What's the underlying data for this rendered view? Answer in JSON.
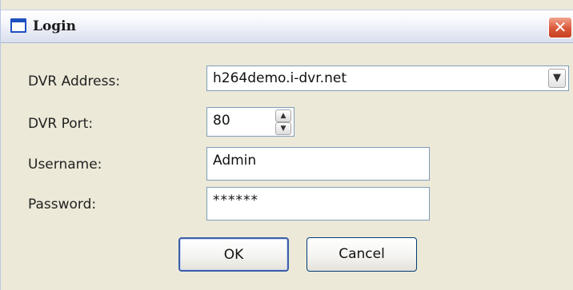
{
  "dialog": {
    "title": "Login",
    "close_glyph": "✕"
  },
  "form": {
    "address_label": "DVR Address:",
    "address_value": "h264demo.i-dvr.net",
    "port_label": "DVR Port:",
    "port_value": "80",
    "username_label": "Username:",
    "username_value": "Admin",
    "password_label": "Password:",
    "password_value": "******"
  },
  "buttons": {
    "ok_label": "OK",
    "cancel_label": "Cancel"
  },
  "icons": {
    "title": "window-icon",
    "close": "close-icon",
    "dropdown": "chevron-down-icon",
    "spin_up": "arrow-up-icon",
    "spin_down": "arrow-down-icon"
  }
}
